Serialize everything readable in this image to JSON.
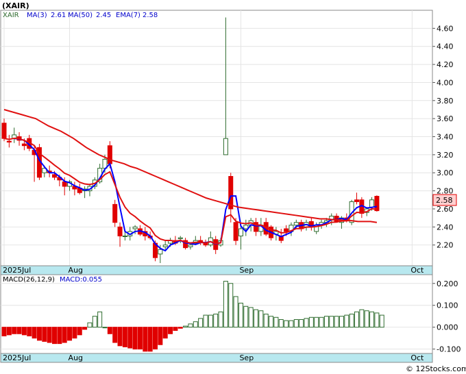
{
  "chart_data": [
    {
      "type": "candlestick",
      "ticker_label": "(XAIR)",
      "legend": {
        "symbol": "XAIR",
        "ma3": "MA(3)",
        "ma3_value": "2.61",
        "ma50": "MA(50)",
        "ma50_value": "2.45",
        "ema7": "EMA(7)",
        "ema7_value": "2.58"
      },
      "last_price_label": "2.58",
      "y_ticks": [
        "4.60",
        "4.40",
        "4.20",
        "4.00",
        "3.80",
        "3.60",
        "3.40",
        "3.20",
        "3.00",
        "2.80",
        "2.60",
        "2.40",
        "2.20"
      ],
      "ylim": [
        1.97,
        4.8
      ],
      "x_labels": [
        {
          "label": "2025Jul",
          "index": 0
        },
        {
          "label": "Aug",
          "index": 13
        },
        {
          "label": "Sep",
          "index": 47
        },
        {
          "label": "Oct",
          "index": 81
        }
      ],
      "colors": {
        "up": "#2e6b2e",
        "down": "#e00000",
        "ma3": "#0000ff",
        "ma50": "#e01010",
        "ema7": "#e01010"
      },
      "candles": [
        [
          3.55,
          3.6,
          3.35,
          3.38
        ],
        [
          3.35,
          3.42,
          3.28,
          3.34
        ],
        [
          3.38,
          3.5,
          3.33,
          3.42
        ],
        [
          3.4,
          3.45,
          3.3,
          3.36
        ],
        [
          3.32,
          3.38,
          3.25,
          3.3
        ],
        [
          3.38,
          3.42,
          3.24,
          3.27
        ],
        [
          3.25,
          3.3,
          2.9,
          3.2
        ],
        [
          3.28,
          3.32,
          2.92,
          2.95
        ],
        [
          3.0,
          3.08,
          2.95,
          3.05
        ],
        [
          3.02,
          3.08,
          2.95,
          3.0
        ],
        [
          2.98,
          3.02,
          2.92,
          2.95
        ],
        [
          2.95,
          2.98,
          2.85,
          2.92
        ],
        [
          2.9,
          2.95,
          2.75,
          2.85
        ],
        [
          2.85,
          2.92,
          2.8,
          2.9
        ],
        [
          2.85,
          2.9,
          2.75,
          2.82
        ],
        [
          2.83,
          2.88,
          2.76,
          2.78
        ],
        [
          2.8,
          2.85,
          2.72,
          2.82
        ],
        [
          2.8,
          2.88,
          2.74,
          2.85
        ],
        [
          2.85,
          2.95,
          2.82,
          2.92
        ],
        [
          2.9,
          3.1,
          2.88,
          3.05
        ],
        [
          3.05,
          3.2,
          3.0,
          3.15
        ],
        [
          3.3,
          3.35,
          3.05,
          3.1
        ],
        [
          2.65,
          2.7,
          2.4,
          2.45
        ],
        [
          2.4,
          2.45,
          2.18,
          2.3
        ],
        [
          2.3,
          2.35,
          2.25,
          2.3
        ],
        [
          2.3,
          2.4,
          2.25,
          2.35
        ],
        [
          2.38,
          2.42,
          2.32,
          2.4
        ],
        [
          2.38,
          2.42,
          2.3,
          2.32
        ],
        [
          2.35,
          2.4,
          2.25,
          2.3
        ],
        [
          2.3,
          2.35,
          2.26,
          2.28
        ],
        [
          2.22,
          2.25,
          2.02,
          2.06
        ],
        [
          2.1,
          2.2,
          2.0,
          2.15
        ],
        [
          2.18,
          2.25,
          2.15,
          2.2
        ],
        [
          2.22,
          2.28,
          2.18,
          2.25
        ],
        [
          2.25,
          2.3,
          2.2,
          2.22
        ],
        [
          2.27,
          2.3,
          2.22,
          2.28
        ],
        [
          2.25,
          2.28,
          2.15,
          2.17
        ],
        [
          2.18,
          2.22,
          2.15,
          2.2
        ],
        [
          2.22,
          2.3,
          2.2,
          2.25
        ],
        [
          2.25,
          2.3,
          2.2,
          2.23
        ],
        [
          2.22,
          2.26,
          2.18,
          2.2
        ],
        [
          2.2,
          2.35,
          2.18,
          2.28
        ],
        [
          2.26,
          2.3,
          2.1,
          2.15
        ],
        [
          2.2,
          2.28,
          2.18,
          2.25
        ],
        [
          3.2,
          4.72,
          3.2,
          3.38
        ],
        [
          2.96,
          3.0,
          2.45,
          2.6
        ],
        [
          2.45,
          2.5,
          2.2,
          2.25
        ],
        [
          2.3,
          2.4,
          2.15,
          2.38
        ],
        [
          2.38,
          2.48,
          2.3,
          2.42
        ],
        [
          2.42,
          2.5,
          2.35,
          2.47
        ],
        [
          2.45,
          2.5,
          2.3,
          2.35
        ],
        [
          2.35,
          2.5,
          2.3,
          2.42
        ],
        [
          2.45,
          2.5,
          2.3,
          2.32
        ],
        [
          2.4,
          2.42,
          2.25,
          2.28
        ],
        [
          2.32,
          2.4,
          2.25,
          2.35
        ],
        [
          2.3,
          2.38,
          2.22,
          2.25
        ],
        [
          2.38,
          2.42,
          2.3,
          2.35
        ],
        [
          2.35,
          2.45,
          2.3,
          2.42
        ],
        [
          2.42,
          2.48,
          2.38,
          2.45
        ],
        [
          2.45,
          2.48,
          2.35,
          2.38
        ],
        [
          2.4,
          2.48,
          2.36,
          2.45
        ],
        [
          2.46,
          2.5,
          2.36,
          2.4
        ],
        [
          2.35,
          2.45,
          2.32,
          2.42
        ],
        [
          2.42,
          2.48,
          2.38,
          2.45
        ],
        [
          2.45,
          2.5,
          2.4,
          2.47
        ],
        [
          2.48,
          2.55,
          2.42,
          2.52
        ],
        [
          2.52,
          2.55,
          2.45,
          2.46
        ],
        [
          2.45,
          2.52,
          2.38,
          2.5
        ],
        [
          2.5,
          2.55,
          2.45,
          2.48
        ],
        [
          2.45,
          2.7,
          2.42,
          2.68
        ],
        [
          2.7,
          2.78,
          2.65,
          2.68
        ],
        [
          2.7,
          2.73,
          2.5,
          2.55
        ],
        [
          2.56,
          2.62,
          2.52,
          2.6
        ],
        [
          2.62,
          2.73,
          2.58,
          2.7
        ],
        [
          2.74,
          2.75,
          2.57,
          2.58
        ]
      ],
      "ma50": [
        3.7,
        3.68,
        3.66,
        3.64,
        3.62,
        3.6,
        3.56,
        3.52,
        3.49,
        3.46,
        3.42,
        3.38,
        3.33,
        3.28,
        3.24,
        3.2,
        3.17,
        3.14,
        3.12,
        3.1,
        3.07,
        3.05,
        3.02,
        2.99,
        2.96,
        2.93,
        2.9,
        2.87,
        2.84,
        2.81,
        2.78,
        2.75,
        2.72,
        2.7,
        2.68,
        2.66,
        2.64,
        2.62,
        2.61,
        2.6,
        2.59,
        2.58,
        2.57,
        2.56,
        2.55,
        2.54,
        2.53,
        2.52,
        2.51,
        2.5,
        2.49,
        2.49,
        2.48,
        2.48,
        2.47,
        2.47,
        2.46,
        2.46,
        2.46,
        2.45
      ],
      "macd_legend": {
        "label": "MACD(26,12,9)",
        "value": "MACD:0.055"
      },
      "macd_y_ticks": [
        "0.200",
        "0.100",
        "0.000",
        "-0.100"
      ],
      "macd_ylim": [
        -0.12,
        0.24
      ],
      "macd_hist": [
        -0.04,
        -0.035,
        -0.03,
        -0.03,
        -0.035,
        -0.04,
        -0.05,
        -0.06,
        -0.065,
        -0.07,
        -0.075,
        -0.075,
        -0.07,
        -0.06,
        -0.05,
        -0.035,
        -0.01,
        0.02,
        0.05,
        0.07,
        0.0,
        -0.03,
        -0.07,
        -0.085,
        -0.09,
        -0.095,
        -0.1,
        -0.1,
        -0.11,
        -0.11,
        -0.1,
        -0.08,
        -0.05,
        -0.03,
        -0.015,
        -0.005,
        0.005,
        0.015,
        0.025,
        0.04,
        0.055,
        0.055,
        0.06,
        0.07,
        0.21,
        0.2,
        0.14,
        0.11,
        0.095,
        0.09,
        0.08,
        0.075,
        0.06,
        0.05,
        0.045,
        0.035,
        0.03,
        0.03,
        0.035,
        0.035,
        0.04,
        0.045,
        0.045,
        0.045,
        0.05,
        0.05,
        0.05,
        0.05,
        0.055,
        0.06,
        0.07,
        0.08,
        0.075,
        0.07,
        0.065,
        0.055
      ]
    }
  ],
  "watermark": "© 12Stocks.com"
}
